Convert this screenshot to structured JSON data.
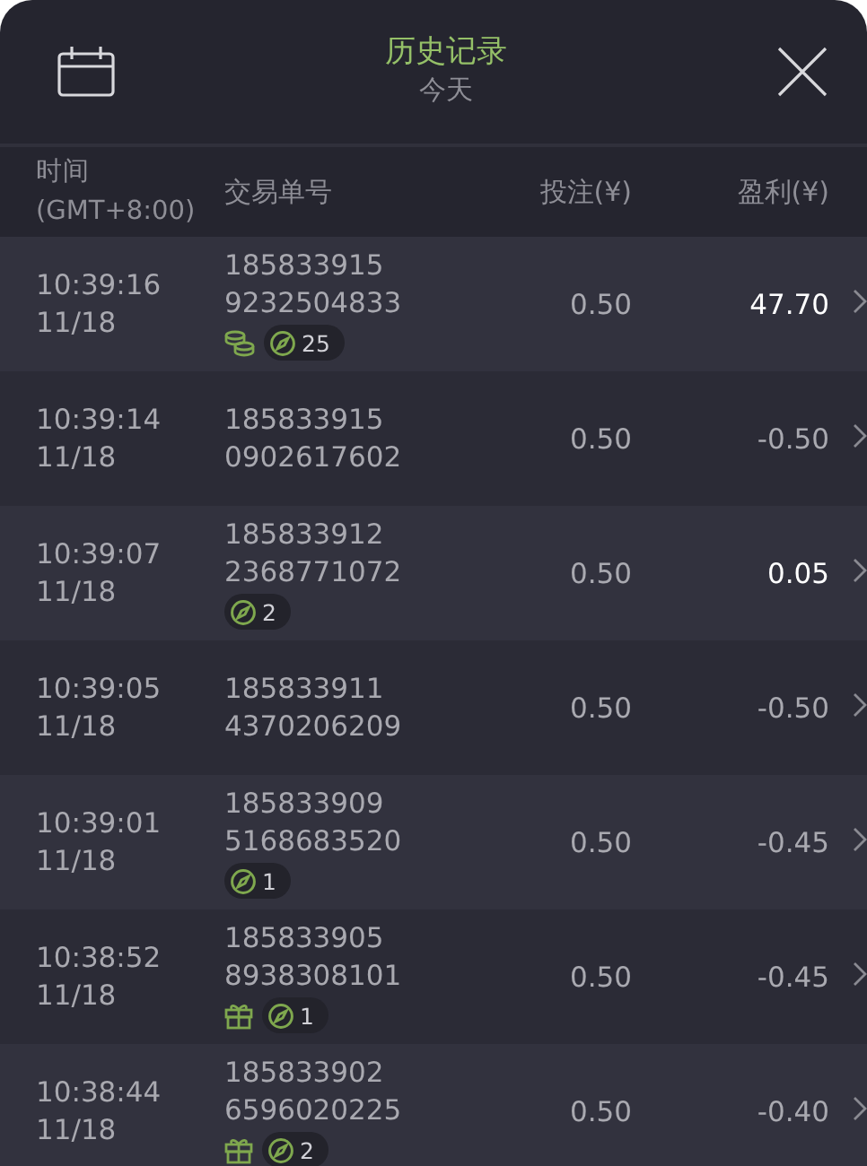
{
  "header": {
    "title": "历史记录",
    "subtitle": "今天"
  },
  "columns": [
    {
      "label": "时间\n(GMT+8:00)"
    },
    {
      "label": "交易单号"
    },
    {
      "label": "投注(¥)"
    },
    {
      "label": "盈利(¥)"
    }
  ],
  "rows": [
    {
      "time": "10:39:16",
      "date": "11/18",
      "order_1": "185833915",
      "order_2": "9232504833",
      "icons": [
        {
          "kind": "coins"
        }
      ],
      "badge": "25",
      "stake": "0.50",
      "profit": "47.70",
      "positive": true
    },
    {
      "time": "10:39:14",
      "date": "11/18",
      "order_1": "185833915",
      "order_2": "0902617602",
      "icons": [],
      "stake": "0.50",
      "profit": "-0.50",
      "positive": false
    },
    {
      "time": "10:39:07",
      "date": "11/18",
      "order_1": "185833912",
      "order_2": "2368771072",
      "icons": [],
      "badge": "2",
      "stake": "0.50",
      "profit": "0.05",
      "positive": true
    },
    {
      "time": "10:39:05",
      "date": "11/18",
      "order_1": "185833911",
      "order_2": "4370206209",
      "icons": [],
      "stake": "0.50",
      "profit": "-0.50",
      "positive": false
    },
    {
      "time": "10:39:01",
      "date": "11/18",
      "order_1": "185833909",
      "order_2": "5168683520",
      "icons": [],
      "badge": "1",
      "stake": "0.50",
      "profit": "-0.45",
      "positive": false
    },
    {
      "time": "10:38:52",
      "date": "11/18",
      "order_1": "185833905",
      "order_2": "8938308101",
      "icons": [
        {
          "kind": "gift"
        }
      ],
      "badge": "1",
      "stake": "0.50",
      "profit": "-0.45",
      "positive": false
    },
    {
      "time": "10:38:44",
      "date": "11/18",
      "order_1": "185833902",
      "order_2": "6596020225",
      "icons": [
        {
          "kind": "gift"
        }
      ],
      "badge": "2",
      "stake": "0.50",
      "profit": "-0.40",
      "positive": false
    }
  ]
}
